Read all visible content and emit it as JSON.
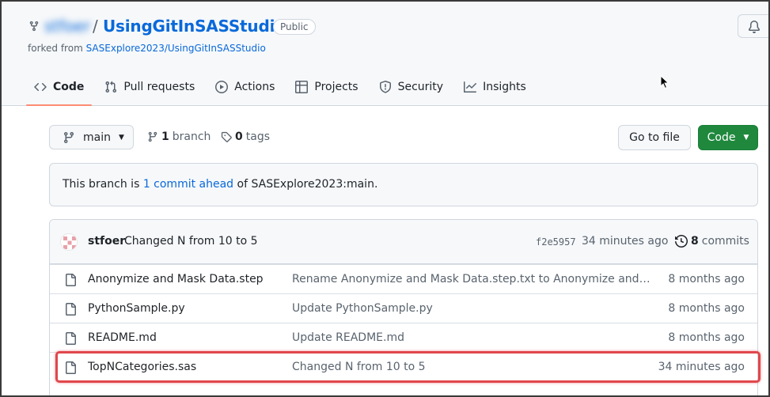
{
  "repo": {
    "owner": "stfoer",
    "separator": "/",
    "name": "UsingGitInSASStudio",
    "visibility": "Public",
    "forked_prefix": "forked from",
    "forked_source": "SASExplore2023/UsingGitInSASStudio"
  },
  "tabs": [
    {
      "label": "Code",
      "icon": "code-icon",
      "active": true
    },
    {
      "label": "Pull requests",
      "icon": "pull-request-icon"
    },
    {
      "label": "Actions",
      "icon": "play-icon"
    },
    {
      "label": "Projects",
      "icon": "table-icon"
    },
    {
      "label": "Security",
      "icon": "shield-icon"
    },
    {
      "label": "Insights",
      "icon": "graph-icon"
    }
  ],
  "toolbar": {
    "branch": "main",
    "branch_count": "1",
    "branch_label": "branch",
    "tag_count": "0",
    "tag_label": "tags",
    "goto_file": "Go to file",
    "code": "Code"
  },
  "banner": {
    "prefix": "This branch is",
    "link": "1 commit ahead",
    "suffix": "of SASExplore2023:main."
  },
  "latest_commit": {
    "author": "stfoer",
    "message": "Changed N from 10 to 5",
    "sha": "f2e5957",
    "time": "34 minutes ago",
    "count": "8",
    "count_label": "commits"
  },
  "files": [
    {
      "name": "Anonymize and Mask Data.step",
      "message": "Rename Anonymize and Mask Data.step.txt to Anonymize and Mask Data.step",
      "time": "8 months ago"
    },
    {
      "name": "PythonSample.py",
      "message": "Update PythonSample.py",
      "time": "8 months ago"
    },
    {
      "name": "README.md",
      "message": "Update README.md",
      "time": "8 months ago"
    },
    {
      "name": "TopNCategories.sas",
      "message": "Changed N from 10 to 5",
      "time": "34 minutes ago"
    }
  ],
  "colors": {
    "accent": "#0969da",
    "primary_button": "#1f883d",
    "tab_underline": "#fd8c73",
    "highlight_box": "#e0474c"
  }
}
